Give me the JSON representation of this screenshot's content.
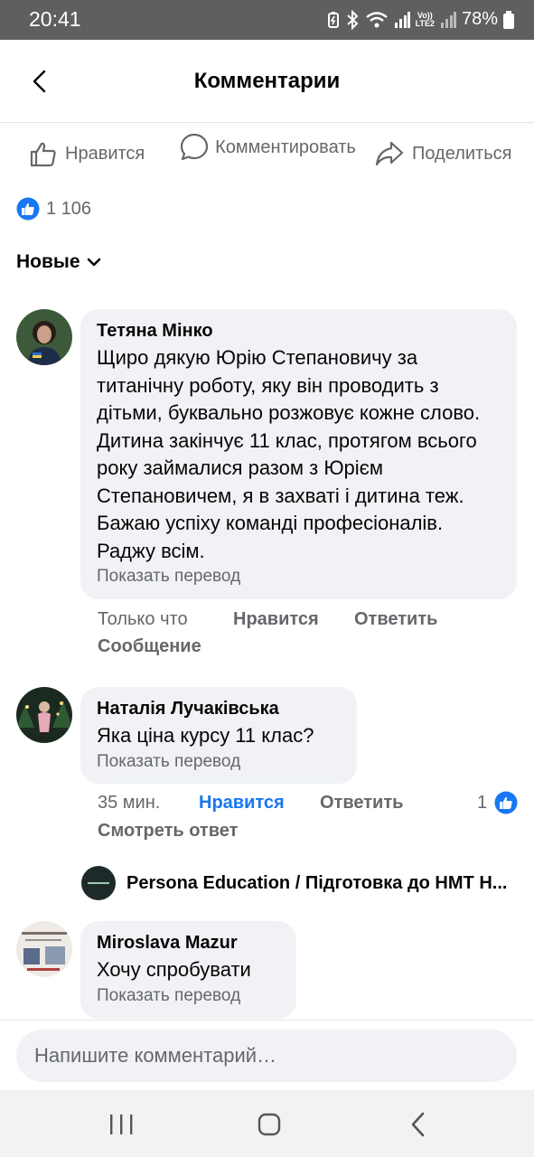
{
  "status_bar": {
    "time": "20:41",
    "network": "LTE2",
    "volte": "Vo))",
    "battery": "78%"
  },
  "header": {
    "title": "Комментарии"
  },
  "actions": {
    "like": "Нравится",
    "comment": "Комментировать",
    "share": "Поделиться"
  },
  "reactions": {
    "count": "1 106"
  },
  "sort": {
    "label": "Новые"
  },
  "comments": [
    {
      "author": "Тетяна Мінко",
      "text": "Щиро дякую Юрію Степановичу за титанічну роботу, яку він проводить з дітьми, буквально розжовує кожне слово. Дитина закінчує 11 клас, протягом всього року займалися разом з Юрієм Степановичем, я в захваті і дитина теж. Бажаю успіху команді професіоналів. Раджу всім.",
      "translate": "Показать перевод",
      "time": "Только что",
      "like": "Нравится",
      "reply": "Ответить",
      "message": "Сообщение"
    },
    {
      "author": "Наталія Лучаківська",
      "text": "Яка ціна курсу 11 клас?",
      "translate": "Показать перевод",
      "time": "35 мин.",
      "like": "Нравится",
      "reply": "Ответить",
      "likes_count": "1",
      "view_reply": "Смотреть ответ",
      "reply_preview": "Persona Education / Підготовка до НМТ Н..."
    },
    {
      "author": "Miroslava Mazur",
      "text": "Хочу спробувати",
      "translate": "Показать перевод"
    }
  ],
  "composer": {
    "placeholder": "Напишите комментарий…"
  },
  "colors": {
    "accent": "#1877f2",
    "bubble": "#f0f2f5",
    "secondary_text": "#65676b",
    "status_bar": "#5f5f5f"
  }
}
